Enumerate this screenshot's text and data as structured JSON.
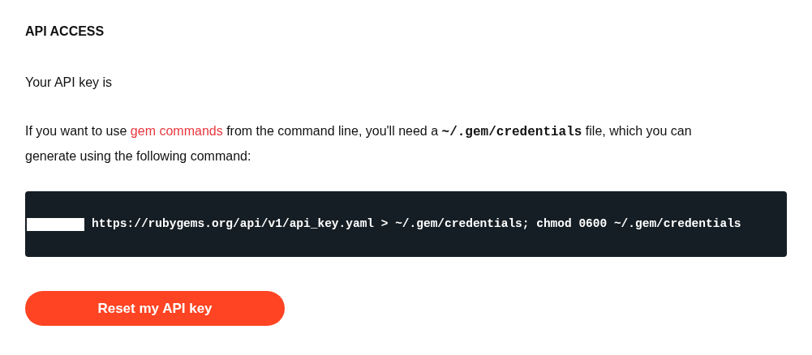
{
  "heading": "API ACCESS",
  "api_key_text": "Your API key is",
  "instructions": {
    "before": "If you want to use",
    "link": "gem commands",
    "middle": "from the command line, you'll need a",
    "code": "~/.gem/credentials",
    "after": "file, which you can generate using the following command:"
  },
  "command": {
    "redacted": true,
    "text": "https://rubygems.org/api/v1/api_key.yaml > ~/.gem/credentials; chmod 0600 ~/.gem/credentials"
  },
  "reset_button": "Reset my API key"
}
